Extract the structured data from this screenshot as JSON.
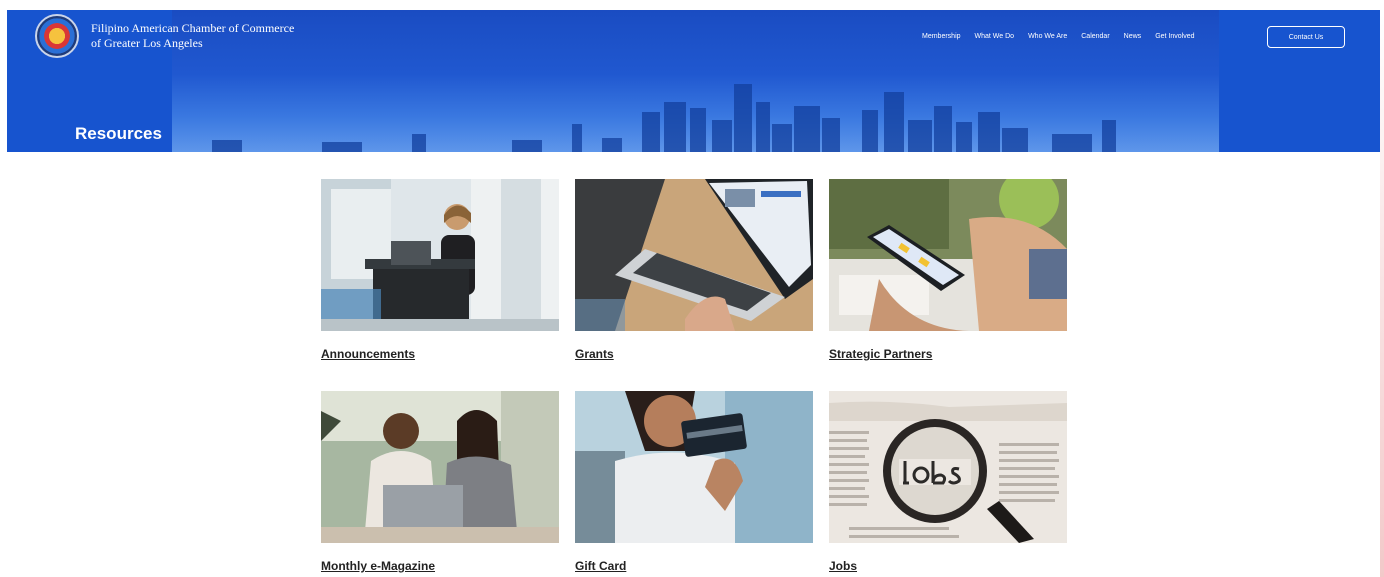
{
  "header": {
    "org_name_line1": "Filipino American Chamber of Commerce",
    "org_name_line2": "of Greater Los Angeles",
    "page_title": "Resources"
  },
  "nav": {
    "items": [
      "Membership",
      "What We Do",
      "Who We Are",
      "Calendar",
      "News",
      "Get Involved"
    ],
    "contact_label": "Contact Us"
  },
  "resources": [
    {
      "label": "Announcements",
      "image": "woman-at-podium-photo"
    },
    {
      "label": "Grants",
      "image": "laptop-typing-photo"
    },
    {
      "label": "Strategic Partners",
      "image": "phone-in-hands-photo"
    },
    {
      "label": "Monthly e-Magazine",
      "image": "two-women-laptop-photo"
    },
    {
      "label": "Gift Card",
      "image": "woman-holding-card-photo"
    },
    {
      "label": "Jobs",
      "image": "magnifier-jobs-newspaper-photo"
    }
  ],
  "colors": {
    "header_blue": "#1754cf",
    "label_text": "#222222"
  }
}
